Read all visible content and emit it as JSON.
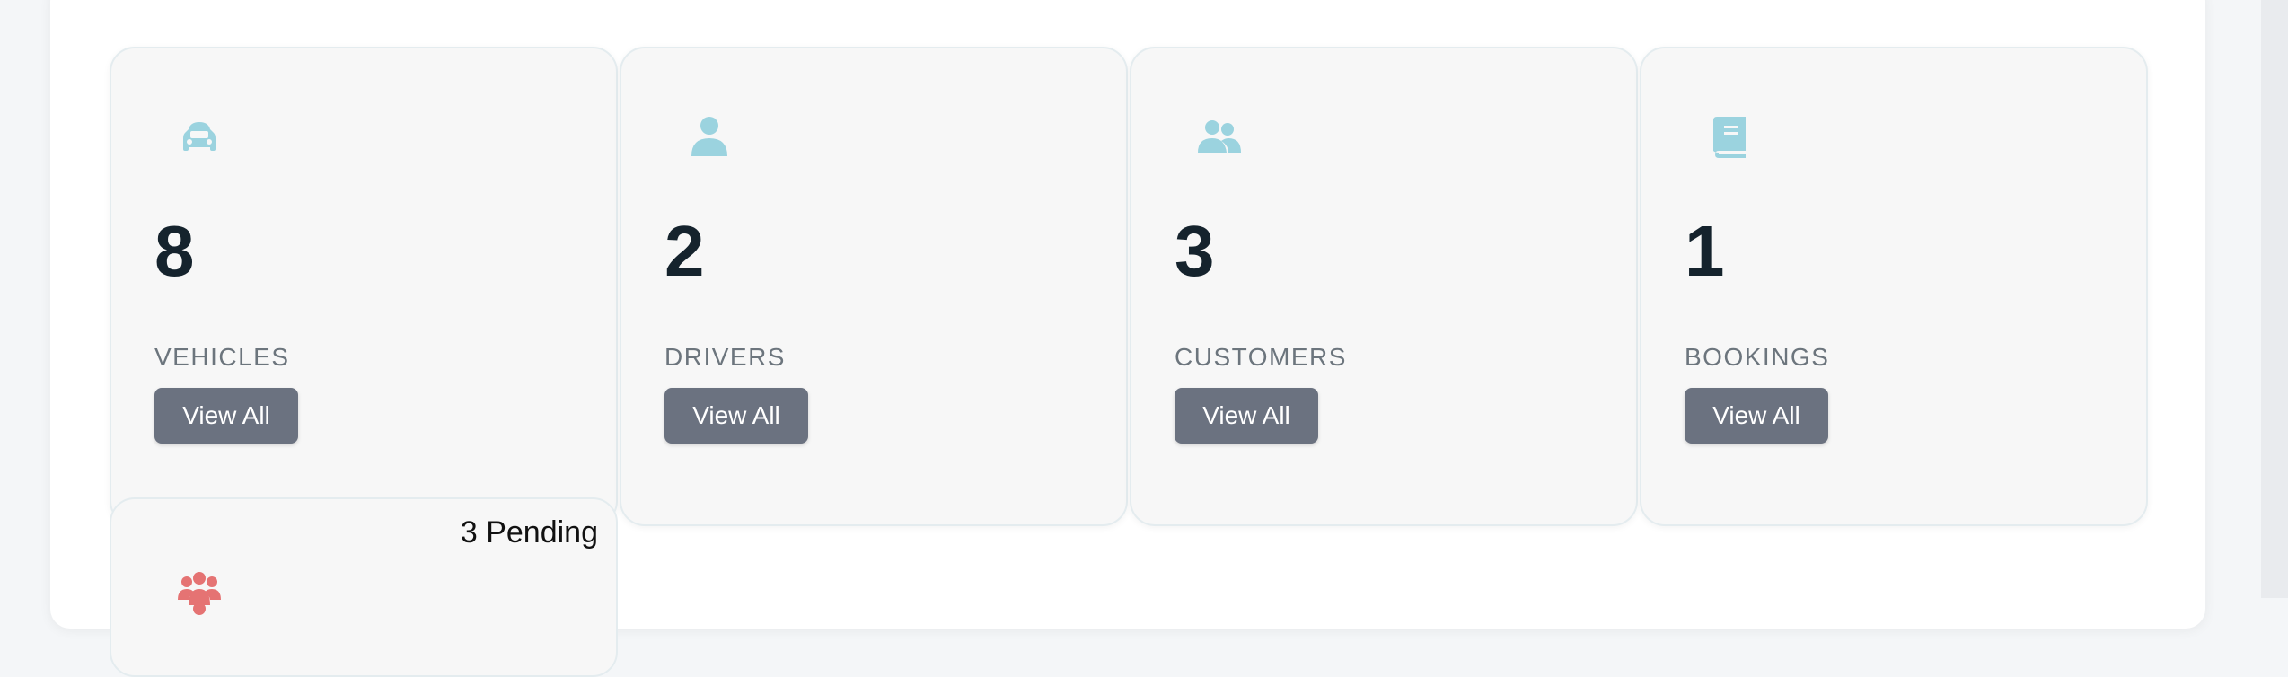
{
  "cards": [
    {
      "count": "8",
      "label": "VEHICLES",
      "button": "View All",
      "icon": "car-icon"
    },
    {
      "count": "2",
      "label": "DRIVERS",
      "button": "View All",
      "icon": "user-icon"
    },
    {
      "count": "3",
      "label": "CUSTOMERS",
      "button": "View All",
      "icon": "users-icon"
    },
    {
      "count": "1",
      "label": "BOOKINGS",
      "button": "View All",
      "icon": "book-icon"
    }
  ],
  "pending": {
    "text": "3 Pending",
    "icon": "user-group-icon"
  },
  "colors": {
    "icon_accent": "#9bd3df",
    "pending_icon": "#e57373",
    "count_text": "#15232d",
    "label_text": "#6c757d",
    "button_bg": "#6b7280"
  }
}
